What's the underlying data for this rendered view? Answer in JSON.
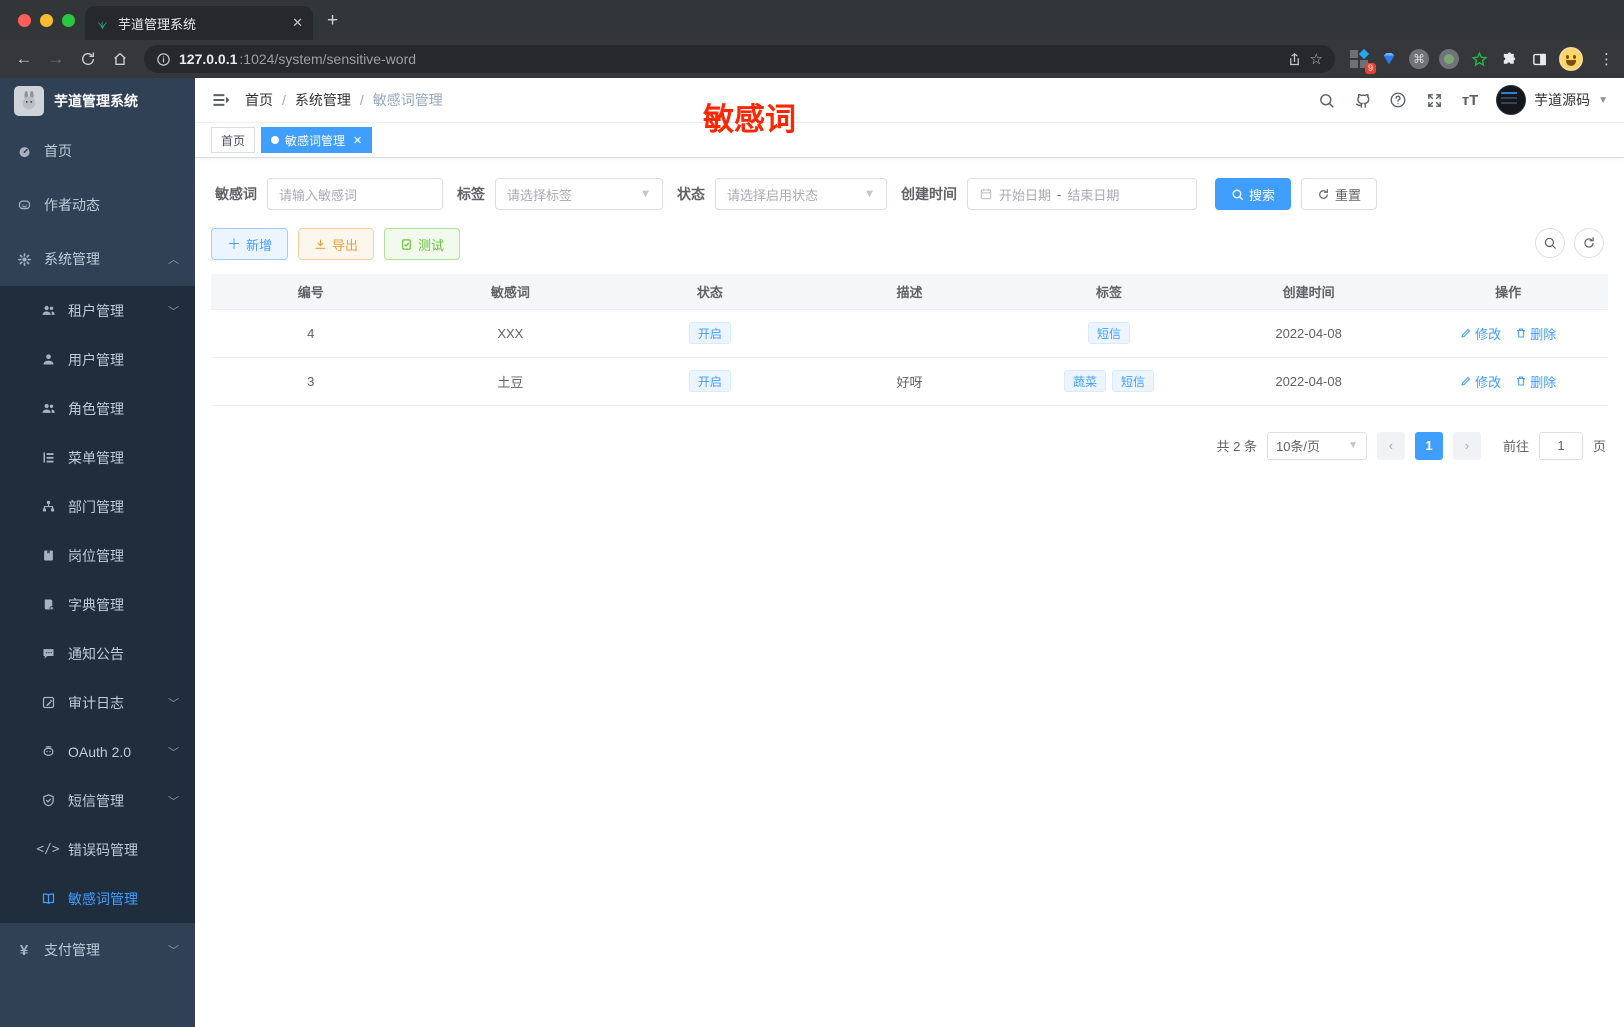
{
  "browser": {
    "tab_title": "芋道管理系统",
    "url_host": "127.0.0.1",
    "url_rest": ":1024/system/sensitive-word",
    "extension_badge": "9"
  },
  "sidebar": {
    "title": "芋道管理系统",
    "items": [
      {
        "label": "首页",
        "icon": "dashboard-icon",
        "type": "top"
      },
      {
        "label": "作者动态",
        "icon": "author-chat-icon",
        "type": "top"
      },
      {
        "label": "系统管理",
        "icon": "gear-icon",
        "type": "top",
        "arrow": "up"
      },
      {
        "label": "租户管理",
        "icon": "people-icon",
        "type": "sub",
        "arrow": "down"
      },
      {
        "label": "用户管理",
        "icon": "person-icon",
        "type": "sub"
      },
      {
        "label": "角色管理",
        "icon": "people-icon",
        "type": "sub"
      },
      {
        "label": "菜单管理",
        "icon": "menu-tree-icon",
        "type": "sub"
      },
      {
        "label": "部门管理",
        "icon": "org-tree-icon",
        "type": "sub"
      },
      {
        "label": "岗位管理",
        "icon": "badge-icon",
        "type": "sub"
      },
      {
        "label": "字典管理",
        "icon": "dict-book-icon",
        "type": "sub"
      },
      {
        "label": "通知公告",
        "icon": "message-icon",
        "type": "sub"
      },
      {
        "label": "审计日志",
        "icon": "log-pen-icon",
        "type": "sub",
        "arrow": "down"
      },
      {
        "label": "OAuth 2.0",
        "icon": "robot-icon",
        "type": "sub",
        "arrow": "down"
      },
      {
        "label": "短信管理",
        "icon": "shield-icon",
        "type": "sub",
        "arrow": "down"
      },
      {
        "label": "错误码管理",
        "icon": "code-icon",
        "type": "sub"
      },
      {
        "label": "敏感词管理",
        "icon": "book-open-icon",
        "type": "sub",
        "active": true
      },
      {
        "label": "支付管理",
        "icon": "yen-icon",
        "type": "top",
        "arrow": "down"
      }
    ]
  },
  "navbar": {
    "breadcrumb": [
      "首页",
      "系统管理",
      "敏感词管理"
    ],
    "username": "芋道源码"
  },
  "annotation": {
    "text": "敏感词",
    "color": "#ff2600"
  },
  "tagsview": [
    {
      "label": "首页",
      "active": false,
      "closable": false
    },
    {
      "label": "敏感词管理",
      "active": true,
      "closable": true
    }
  ],
  "filters": {
    "keyword_label": "敏感词",
    "keyword_placeholder": "请输入敏感词",
    "tag_label": "标签",
    "tag_placeholder": "请选择标签",
    "status_label": "状态",
    "status_placeholder": "请选择启用状态",
    "date_label": "创建时间",
    "date_start": "开始日期",
    "date_sep": "-",
    "date_end": "结束日期",
    "search_label": "搜索",
    "reset_label": "重置"
  },
  "toolbar": {
    "add": "新增",
    "export": "导出",
    "test": "测试"
  },
  "table": {
    "columns": [
      "编号",
      "敏感词",
      "状态",
      "描述",
      "标签",
      "创建时间",
      "操作"
    ],
    "edit_label": "修改",
    "delete_label": "删除",
    "rows": [
      {
        "id": "4",
        "word": "XXX",
        "status": "开启",
        "desc": "",
        "tags": [
          "短信"
        ],
        "created": "2022-04-08"
      },
      {
        "id": "3",
        "word": "土豆",
        "status": "开启",
        "desc": "好呀",
        "tags": [
          "蔬菜",
          "短信"
        ],
        "created": "2022-04-08"
      }
    ]
  },
  "pagination": {
    "total": "共 2 条",
    "size": "10条/页",
    "prev": "‹",
    "next": "›",
    "current": "1",
    "goto_label": "前往",
    "goto_value": "1",
    "unit": "页"
  },
  "colors": {
    "primary": "#409eff",
    "annotation": "#ff2600"
  }
}
